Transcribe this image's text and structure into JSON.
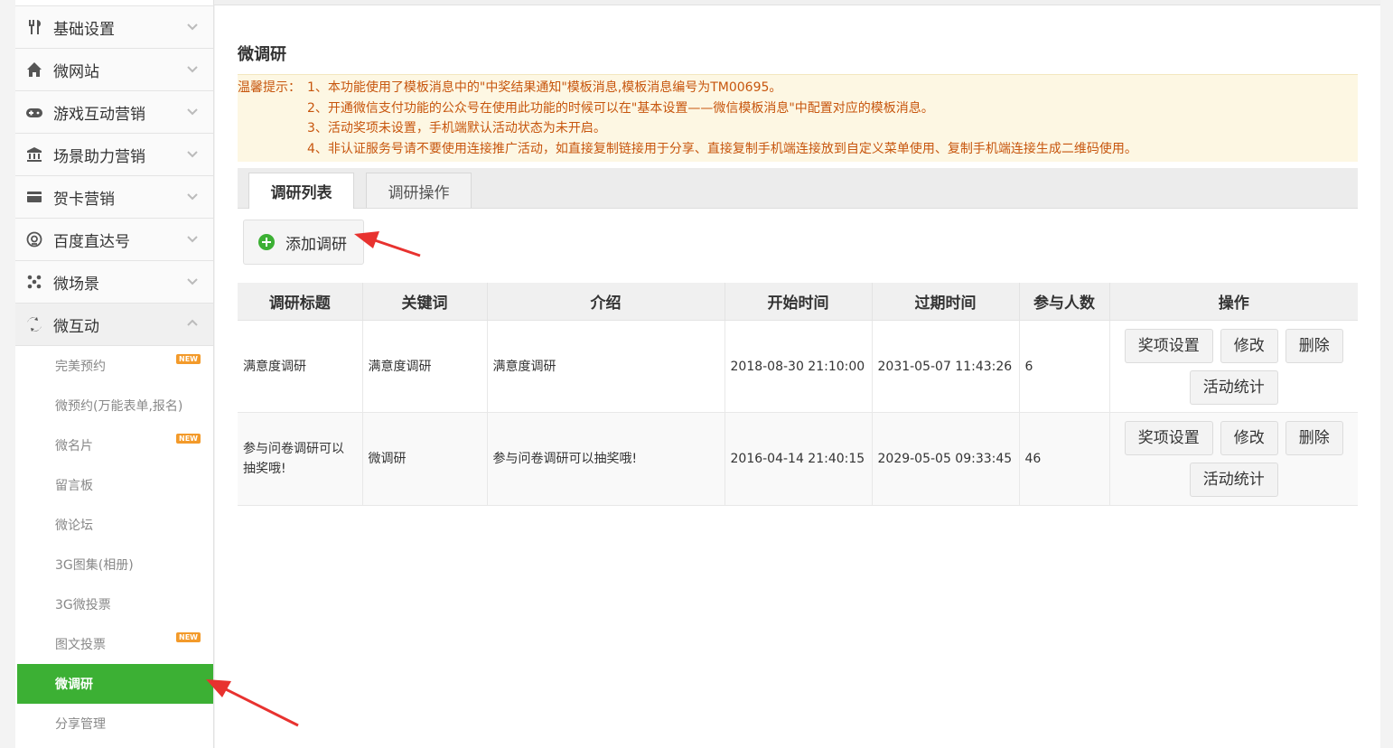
{
  "sidebar": {
    "menu": [
      {
        "label": "基础设置",
        "icon": "tools-icon"
      },
      {
        "label": "微网站",
        "icon": "home-icon"
      },
      {
        "label": "游戏互动营销",
        "icon": "gamepad-icon"
      },
      {
        "label": "场景助力营销",
        "icon": "bank-icon"
      },
      {
        "label": "贺卡营销",
        "icon": "card-icon"
      },
      {
        "label": "百度直达号",
        "icon": "at-icon"
      },
      {
        "label": "微场景",
        "icon": "dots-icon"
      },
      {
        "label": "微互动",
        "icon": "interact-icon"
      }
    ],
    "submenu": [
      {
        "label": "完美预约",
        "badge": "NEW"
      },
      {
        "label": "微预约(万能表单,报名)"
      },
      {
        "label": "微名片",
        "badge": "NEW"
      },
      {
        "label": "留言板"
      },
      {
        "label": "微论坛"
      },
      {
        "label": "3G图集(相册)"
      },
      {
        "label": "3G微投票"
      },
      {
        "label": "图文投票",
        "badge": "NEW"
      },
      {
        "label": "微调研"
      },
      {
        "label": "分享管理"
      }
    ]
  },
  "main": {
    "title": "微调研",
    "notice_label": "温馨提示：",
    "notice_lines": [
      "1、本功能使用了模板消息中的\"中奖结果通知\"模板消息,模板消息编号为TM00695。",
      "2、开通微信支付功能的公众号在使用此功能的时候可以在\"基本设置——微信模板消息\"中配置对应的模板消息。",
      "3、活动奖项未设置，手机端默认活动状态为未开启。",
      "4、非认证服务号请不要使用连接推广活动，如直接复制链接用于分享、直接复制手机端连接放到自定义菜单使用、复制手机端连接生成二维码使用。"
    ],
    "tabs": [
      "调研列表",
      "调研操作"
    ],
    "add_button": "添加调研",
    "table": {
      "headers": [
        "调研标题",
        "关键词",
        "介绍",
        "开始时间",
        "过期时间",
        "参与人数",
        "操作"
      ],
      "rows": [
        {
          "title": "满意度调研",
          "keyword": "满意度调研",
          "intro": "满意度调研",
          "start": "2018-08-30 21:10:00",
          "end": "2031-05-07 11:43:26",
          "count": "6"
        },
        {
          "title": "参与问卷调研可以抽奖哦!",
          "keyword": "微调研",
          "intro": "参与问卷调研可以抽奖哦!",
          "start": "2016-04-14 21:40:15",
          "end": "2029-05-05 09:33:45",
          "count": "46"
        }
      ],
      "actions": [
        "奖项设置",
        "修改",
        "删除",
        "活动统计"
      ]
    }
  },
  "colors": {
    "active_green": "#3cb034",
    "notice_text": "#c7560e",
    "notice_bg": "#fdf7e3",
    "arrow_red": "#e8322f"
  }
}
